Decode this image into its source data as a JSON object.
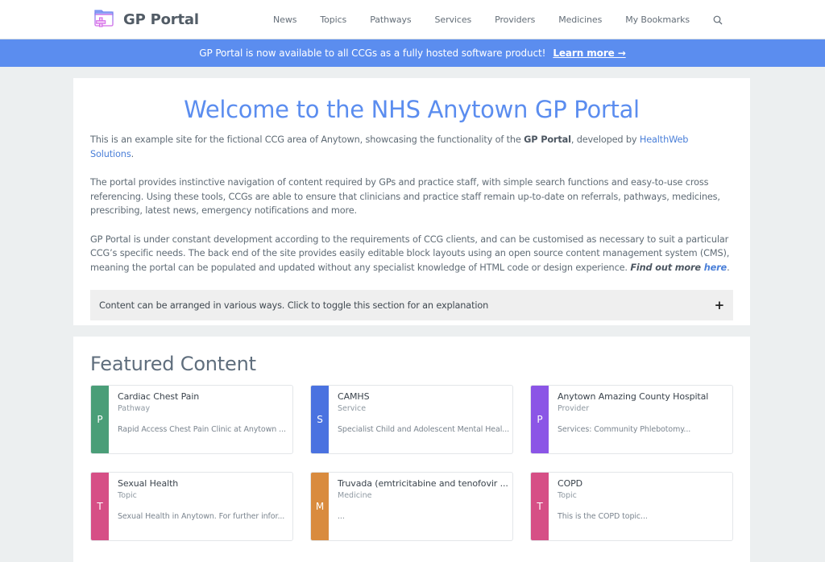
{
  "header": {
    "brand": "GP Portal",
    "nav": [
      {
        "label": "News"
      },
      {
        "label": "Topics"
      },
      {
        "label": "Pathways"
      },
      {
        "label": "Services"
      },
      {
        "label": "Providers"
      },
      {
        "label": "Medicines"
      },
      {
        "label": "My Bookmarks"
      }
    ],
    "search_icon": "search-icon"
  },
  "banner": {
    "text": "GP Portal is now available to all CCGs as a fully hosted software product!",
    "link": "Learn more →"
  },
  "welcome": {
    "title": "Welcome to the NHS Anytown GP Portal",
    "p1_before": "This is an example site for the fictional CCG area of Anytown, showcasing the functionality of the ",
    "p1_bold": "GP Portal",
    "p1_mid": ", developed by ",
    "p1_link": "HealthWeb Solutions",
    "p1_after": ".",
    "p2": "The portal provides instinctive navigation of content required by GPs and practice staff, with simple search functions and easy-to-use cross referencing. Using these tools, CCGs are able to ensure that clinicians and practice staff remain up-to-date on referrals, pathways, medicines, prescribing, latest news, emergency notifications and more.",
    "p3_before": "GP Portal is under constant development according to the requirements of CCG clients, and can be customised as necessary to suit a particular CCG’s specific needs. The back end of the site provides easily editable block layouts using an open source content management system (CMS), meaning the portal can be populated and updated without any specialist knowledge of HTML code or design experience. ",
    "p3_find": "Find out more ",
    "p3_here": "here",
    "p3_after": ".",
    "toggle_label": "Content can be arranged in various ways. Click to toggle this section for an explanation",
    "toggle_icon": "+"
  },
  "featured": {
    "heading": "Featured Content",
    "items": [
      {
        "letter": "P",
        "title": "Cardiac Chest Pain",
        "type": "Pathway",
        "desc": "Rapid Access Chest Pain Clinic at Anytown ...",
        "color": "#4a9e78"
      },
      {
        "letter": "S",
        "title": "CAMHS",
        "type": "Service",
        "desc": "Specialist Child and Adolescent Mental Heal...",
        "color": "#4a72e0"
      },
      {
        "letter": "P",
        "title": "Anytown Amazing County Hospital",
        "type": "Provider",
        "desc": "Services: Community Phlebotomy...",
        "color": "#8b55e6"
      },
      {
        "letter": "T",
        "title": "Sexual Health",
        "type": "Topic",
        "desc": "Sexual Health in Anytown. For further infor...",
        "color": "#d64f86"
      },
      {
        "letter": "M",
        "title": "Truvada (emtricitabine and tenofovir ...",
        "type": "Medicine",
        "desc": "...",
        "color": "#d98b3e"
      },
      {
        "letter": "T",
        "title": "COPD",
        "type": "Topic",
        "desc": "This is the COPD topic...",
        "color": "#d64f86"
      }
    ]
  }
}
